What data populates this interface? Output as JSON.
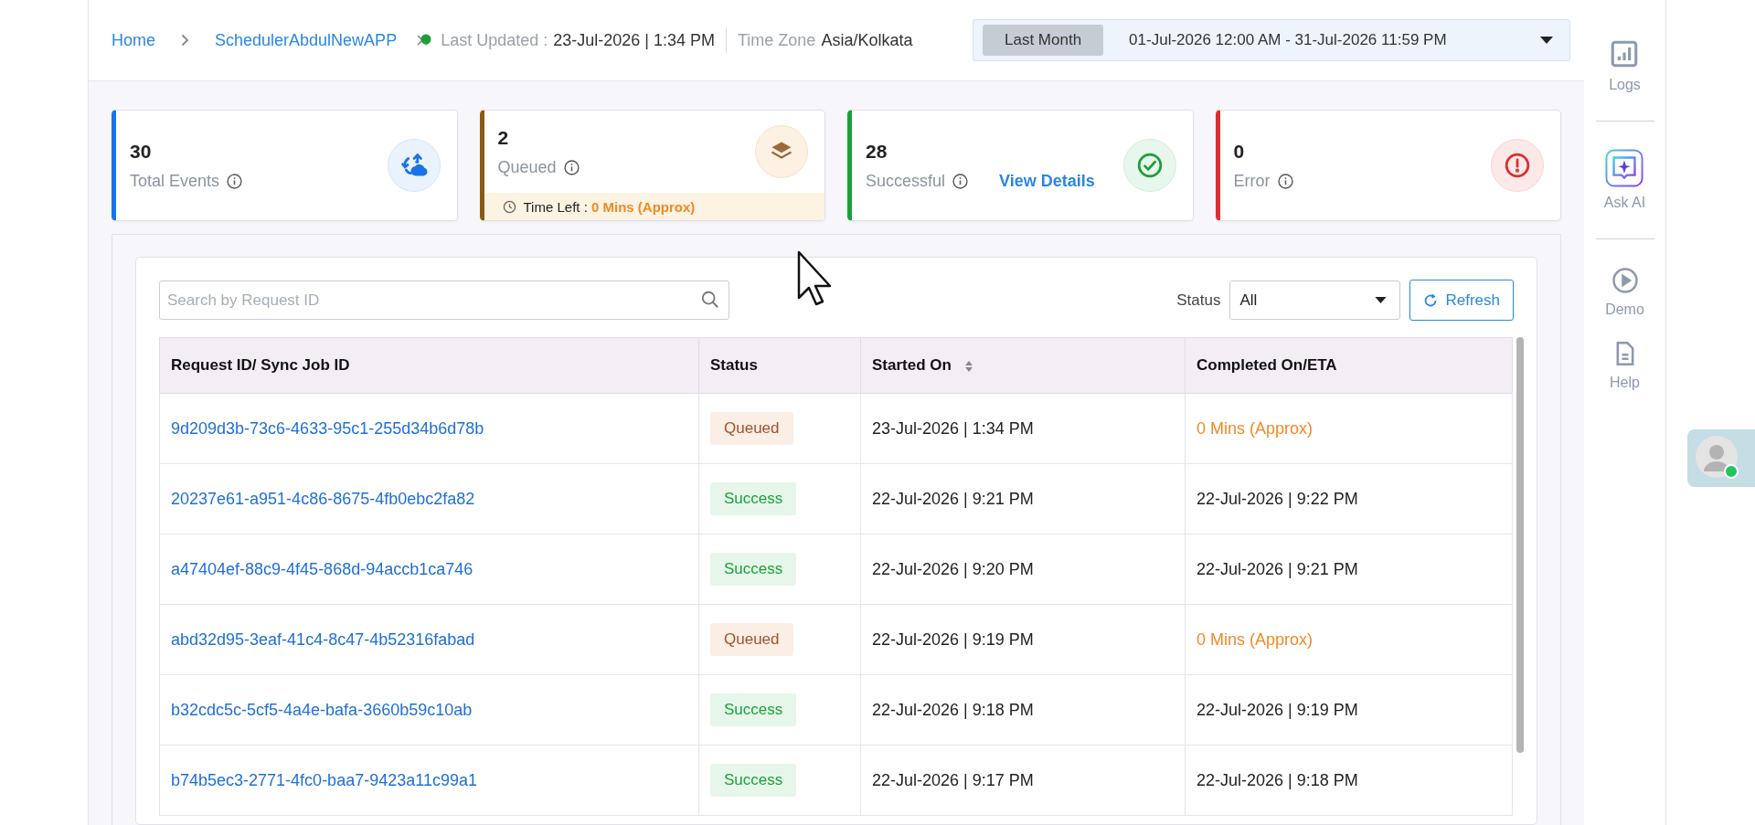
{
  "breadcrumb": [
    {
      "label": "Home"
    },
    {
      "label": "SchedulerAbdulNewAPP"
    }
  ],
  "last_updated": {
    "label": "Last Updated :",
    "value": "23-Jul-2026 | 1:34 PM"
  },
  "time_zone": {
    "label": "Time Zone",
    "value": "Asia/Kolkata"
  },
  "date_range": {
    "preset": "Last Month",
    "range": "01-Jul-2026 12:00 AM - 31-Jul-2026 11:59 PM"
  },
  "stats": [
    {
      "kind": "total",
      "value": "30",
      "label": "Total Events",
      "color": "#1a73e8"
    },
    {
      "kind": "queued",
      "value": "2",
      "label": "Queued",
      "color": "#8a5a14",
      "time_left_label": "Time Left :",
      "time_left": "0 Mins (Approx)"
    },
    {
      "kind": "success",
      "value": "28",
      "label": "Successful",
      "color": "#1e9e3a",
      "link": "View Details"
    },
    {
      "kind": "error",
      "value": "0",
      "label": "Error",
      "color": "#d93030"
    }
  ],
  "search": {
    "placeholder": "Search by Request ID"
  },
  "status_filter": {
    "label": "Status",
    "value": "All"
  },
  "refresh_button": "Refresh",
  "table": {
    "columns": [
      {
        "label": "Request ID/ Sync Job ID",
        "sortable": false
      },
      {
        "label": "Status",
        "sortable": false
      },
      {
        "label": "Started On",
        "sortable": true
      },
      {
        "label": "Completed On/ETA",
        "sortable": false
      }
    ],
    "rows": [
      {
        "id": "9d209d3b-73c6-4633-95c1-255d34b6d78b",
        "status": "Queued",
        "kind": "queued",
        "started": "23-Jul-2026 | 1:34 PM",
        "completed": "0 Mins (Approx)"
      },
      {
        "id": "20237e61-a951-4c86-8675-4fb0ebc2fa82",
        "status": "Success",
        "kind": "success",
        "started": "22-Jul-2026 | 9:21 PM",
        "completed": "22-Jul-2026 | 9:22 PM"
      },
      {
        "id": "a47404ef-88c9-4f45-868d-94accb1ca746",
        "status": "Success",
        "kind": "success",
        "started": "22-Jul-2026 | 9:20 PM",
        "completed": "22-Jul-2026 | 9:21 PM"
      },
      {
        "id": "abd32d95-3eaf-41c4-8c47-4b52316fabad",
        "status": "Queued",
        "kind": "queued",
        "started": "22-Jul-2026 | 9:19 PM",
        "completed": "0 Mins (Approx)"
      },
      {
        "id": "b32cdc5c-5cf5-4a4e-bafa-3660b59c10ab",
        "status": "Success",
        "kind": "success",
        "started": "22-Jul-2026 | 9:18 PM",
        "completed": "22-Jul-2026 | 9:19 PM"
      },
      {
        "id": "b74b5ec3-2771-4fc0-baa7-9423a11c99a1",
        "status": "Success",
        "kind": "success",
        "started": "22-Jul-2026 | 9:17 PM",
        "completed": "22-Jul-2026 | 9:18 PM"
      }
    ]
  },
  "side_nav": [
    {
      "kind": "logs",
      "label": "Logs"
    },
    {
      "kind": "divider"
    },
    {
      "kind": "ai",
      "label": "Ask AI"
    },
    {
      "kind": "divider"
    },
    {
      "kind": "demo",
      "label": "Demo"
    },
    {
      "kind": "help",
      "label": "Help"
    }
  ]
}
